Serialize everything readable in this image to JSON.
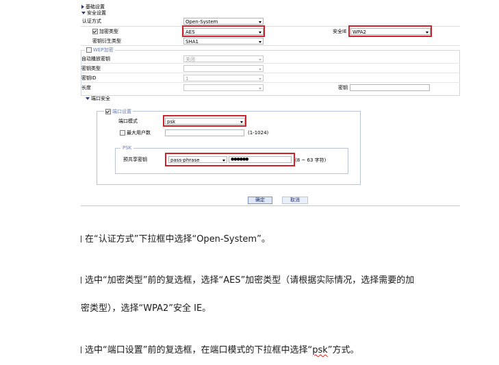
{
  "basic_settings": {
    "label": "基础设置"
  },
  "security_settings": {
    "label": "安全设置",
    "auth_mode": {
      "label": "认证方式",
      "value": "Open-System"
    },
    "encryption_type": {
      "label": "加密类型",
      "checked": true,
      "value": "AES"
    },
    "key_derivation": {
      "label": "密钥衍生类型",
      "value": "SHA1"
    },
    "security_ie": {
      "label": "安全IE",
      "value": "WPA2"
    }
  },
  "wep": {
    "label": "WEP加密",
    "checked": false,
    "auto_key": {
      "label": "自动播放密钥",
      "value": "关闭"
    },
    "key_type": {
      "label": "密钥类型",
      "value": ""
    },
    "key_id": {
      "label": "密钥ID",
      "value": "1"
    },
    "length": {
      "label": "长度",
      "value": ""
    },
    "key": {
      "label": "密钥",
      "value": ""
    }
  },
  "port_security": {
    "label": "端口安全",
    "port_settings": {
      "label": "端口设置",
      "checked": true
    },
    "port_mode": {
      "label": "端口模式",
      "value": "psk"
    },
    "max_users": {
      "label": "最大用户数",
      "value": "",
      "hint": "(1-1024)",
      "checked": false
    },
    "psk": {
      "legend": "PSK",
      "preshared_key_label": "预共享密钥",
      "key_format": "pass-phrase",
      "key_value": "●●●●●●",
      "hint": "(8 ~ 63 字符)"
    }
  },
  "buttons": {
    "ok": "确定",
    "cancel": "取消"
  },
  "instructions": {
    "step1": "在“认证方式”下拉框中选择“Open-System”。",
    "step2_line1": "选中“加密类型”前的复选框，选择“AES”加密类型（请根据实际情况，选择需要的加",
    "step2_line2": "密类型），选择“WPA2”安全 IE。",
    "step3_prefix": "选中“端口设置”前的复选框，在端口模式的下拉框中选择“",
    "step3_psk": "psk",
    "step3_suffix": "”方式。"
  }
}
